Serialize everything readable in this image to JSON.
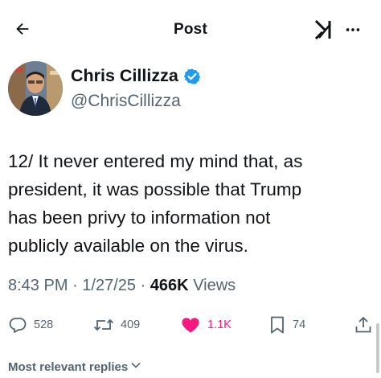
{
  "header": {
    "title": "Post",
    "back_icon": "arrow-left-icon",
    "grok_icon": "grok-icon",
    "more_icon": "more-dots-icon"
  },
  "author": {
    "name": "Chris Cillizza",
    "handle": "@ChrisCillizza",
    "verified": true,
    "verified_color": "#1d9bf0"
  },
  "tweet": {
    "lines": [
      "12/ It never entered my mind that, as",
      "president, it was possible that Trump",
      "has been privy to information not",
      "publicly available on the virus."
    ]
  },
  "meta": {
    "time": "8:43 PM",
    "date": "1/27/25",
    "views_count": "466K",
    "views_label": "Views",
    "separator": "·"
  },
  "actions": {
    "replies": "528",
    "reposts": "409",
    "likes": "1.1K",
    "bookmarks": "74",
    "like_color": "#f91880"
  },
  "replies_sort": {
    "label": "Most relevant replies"
  }
}
